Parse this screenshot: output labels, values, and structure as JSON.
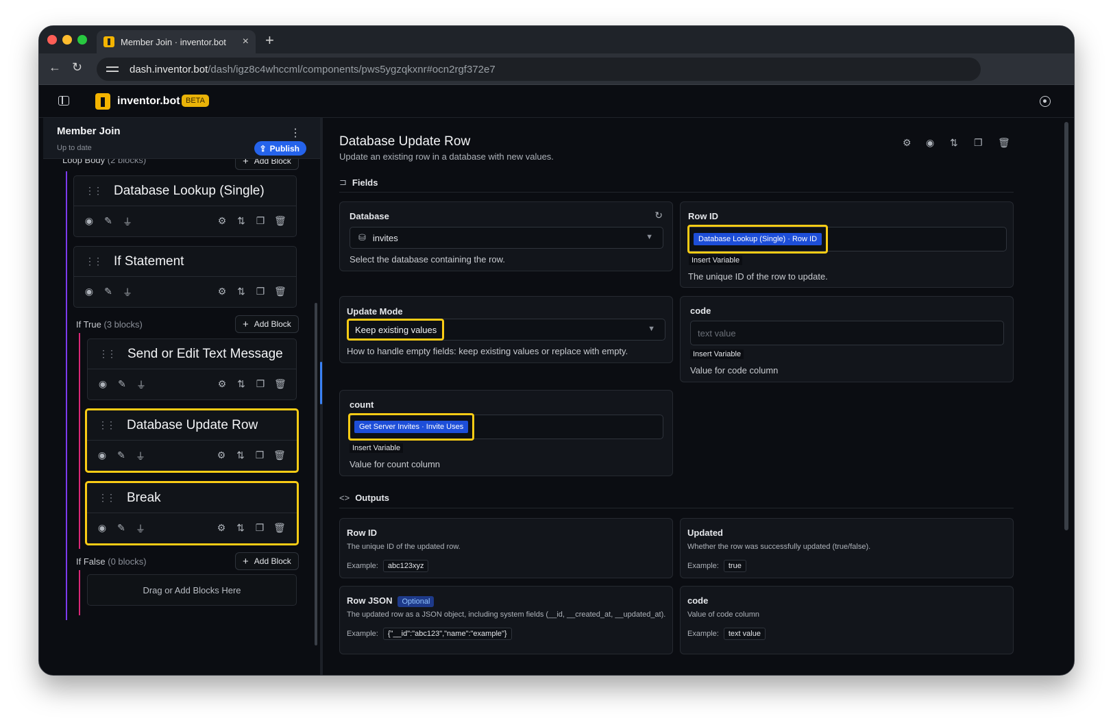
{
  "browser": {
    "tab_title": "Member Join · inventor.bot",
    "url_host": "dash.inventor.bot",
    "url_path": "/dash/igz8c4whccml/components/pws5ygzqkxnr#ocn2rgf372e7",
    "colors": {
      "close": "#ff5f57",
      "minimize": "#febc2e",
      "zoom": "#28c840"
    }
  },
  "app": {
    "brand": "inventor.bot",
    "badge": "BETA",
    "accent": "#facc15",
    "primary": "#2563eb"
  },
  "sidebar": {
    "title": "Member Join",
    "status": "Up to date",
    "publish_label": "Publish",
    "loop_label": "Loop Body",
    "loop_count": "(2 blocks)",
    "loop_add": "Add Block",
    "blocks": [
      {
        "title": "Database Lookup (Single)",
        "highlighted": false
      },
      {
        "title": "If Statement",
        "highlighted": false
      }
    ],
    "if_true": {
      "label": "If True",
      "count": "(3 blocks)",
      "add_label": "Add Block",
      "blocks": [
        {
          "title": "Send or Edit Text Message",
          "highlighted": false
        },
        {
          "title": "Database Update Row",
          "highlighted": true
        },
        {
          "title": "Break",
          "highlighted": true
        }
      ]
    },
    "if_false": {
      "label": "If False",
      "count": "(0 blocks)",
      "add_label": "Add Block",
      "drop_text": "Drag or Add Blocks Here"
    }
  },
  "main": {
    "title": "Database Update Row",
    "description": "Update an existing row in a database with new values.",
    "fields_label": "Fields",
    "outputs_label": "Outputs",
    "fields": {
      "database": {
        "label": "Database",
        "value": "invites",
        "help": "Select the database containing the row."
      },
      "row_id": {
        "label": "Row ID",
        "chip": "Database Lookup (Single) · Row ID",
        "insert": "Insert Variable",
        "help": "The unique ID of the row to update."
      },
      "update_mode": {
        "label": "Update Mode",
        "value": "Keep existing values",
        "help": "How to handle empty fields: keep existing values or replace with empty."
      },
      "code": {
        "label": "code",
        "placeholder": "text value",
        "insert": "Insert Variable",
        "help": "Value for code column"
      },
      "count": {
        "label": "count",
        "chip": "Get Server Invites · Invite Uses",
        "insert": "Insert Variable",
        "help": "Value for count column"
      }
    },
    "outputs": [
      {
        "name": "Row ID",
        "desc": "The unique ID of the updated row.",
        "example_label": "Example:",
        "example": "abc123xyz",
        "optional": ""
      },
      {
        "name": "Updated",
        "desc": "Whether the row was successfully updated (true/false).",
        "example_label": "Example:",
        "example": "true",
        "optional": ""
      },
      {
        "name": "Row JSON",
        "desc": "The updated row as a JSON object, including system fields (__id, __created_at, __updated_at).",
        "example_label": "Example:",
        "example": "{\"__id\":\"abc123\",\"name\":\"example\"}",
        "optional": "Optional"
      },
      {
        "name": "code",
        "desc": "Value of code column",
        "example_label": "Example:",
        "example": "text value",
        "optional": ""
      }
    ]
  }
}
